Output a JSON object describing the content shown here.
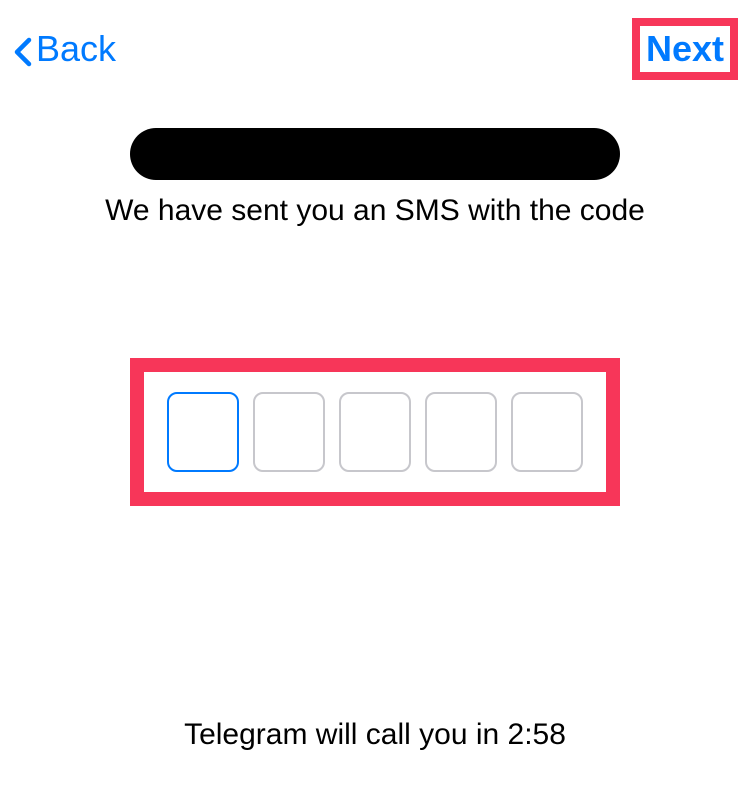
{
  "header": {
    "back_label": "Back",
    "next_label": "Next"
  },
  "main": {
    "sms_message": "We have sent you an SMS with the code",
    "call_message": "Telegram will call you in 2:58"
  },
  "code_input": {
    "digit_count": 5,
    "active_index": 0
  },
  "colors": {
    "accent": "#007aff",
    "highlight": "#f73659"
  }
}
